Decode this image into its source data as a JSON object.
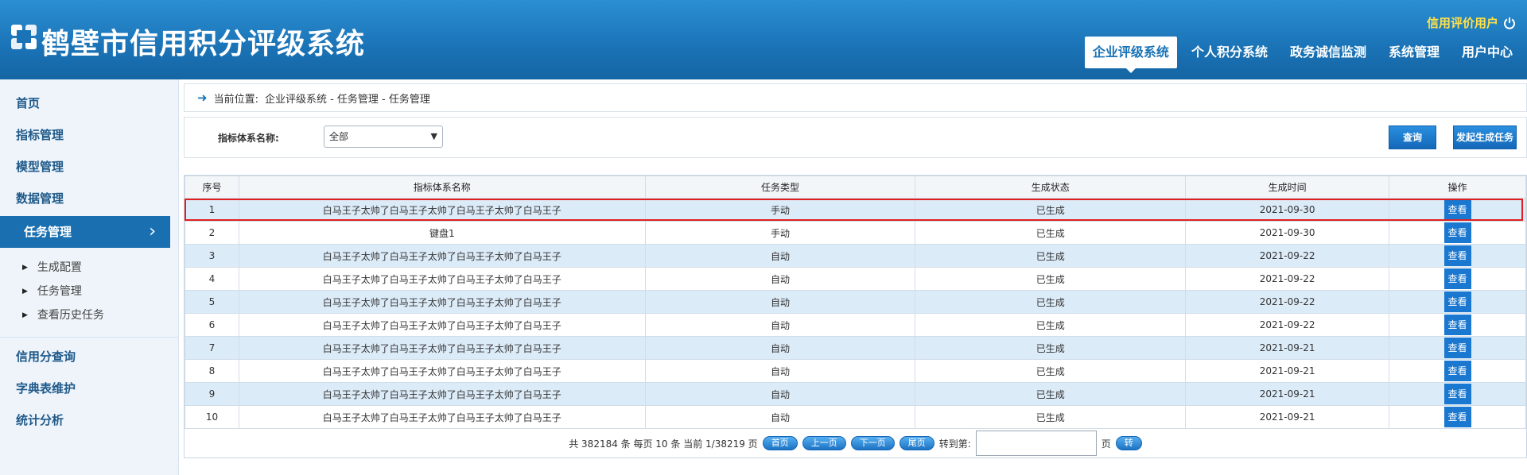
{
  "app": {
    "title": "鹤壁市信用积分评级系统",
    "user": "信用评价用户"
  },
  "top_nav": [
    {
      "label": "企业评级系统",
      "active": true
    },
    {
      "label": "个人积分系统",
      "active": false
    },
    {
      "label": "政务诚信监测",
      "active": false
    },
    {
      "label": "系统管理",
      "active": false
    },
    {
      "label": "用户中心",
      "active": false
    }
  ],
  "sidebar": {
    "items_top": [
      "首页",
      "指标管理",
      "模型管理",
      "数据管理"
    ],
    "active": "任务管理",
    "sub_items": [
      "生成配置",
      "任务管理",
      "查看历史任务"
    ],
    "items_bottom": [
      "信用分查询",
      "字典表维护",
      "统计分析"
    ]
  },
  "breadcrumb": {
    "label": "当前位置:",
    "path": "企业评级系统 - 任务管理 - 任务管理"
  },
  "filter": {
    "label": "指标体系名称:",
    "selected": "全部",
    "query_button": "查询",
    "create_button": "发起生成任务"
  },
  "table": {
    "headers": [
      "序号",
      "指标体系名称",
      "任务类型",
      "生成状态",
      "生成时间",
      "操作"
    ],
    "action_label": "查看",
    "rows": [
      [
        "1",
        "白马王子太帅了白马王子太帅了白马王子太帅了白马王子",
        "手动",
        "已生成",
        "2021-09-30"
      ],
      [
        "2",
        "键盘1",
        "手动",
        "已生成",
        "2021-09-30"
      ],
      [
        "3",
        "白马王子太帅了白马王子太帅了白马王子太帅了白马王子",
        "自动",
        "已生成",
        "2021-09-22"
      ],
      [
        "4",
        "白马王子太帅了白马王子太帅了白马王子太帅了白马王子",
        "自动",
        "已生成",
        "2021-09-22"
      ],
      [
        "5",
        "白马王子太帅了白马王子太帅了白马王子太帅了白马王子",
        "自动",
        "已生成",
        "2021-09-22"
      ],
      [
        "6",
        "白马王子太帅了白马王子太帅了白马王子太帅了白马王子",
        "自动",
        "已生成",
        "2021-09-22"
      ],
      [
        "7",
        "白马王子太帅了白马王子太帅了白马王子太帅了白马王子",
        "自动",
        "已生成",
        "2021-09-21"
      ],
      [
        "8",
        "白马王子太帅了白马王子太帅了白马王子太帅了白马王子",
        "自动",
        "已生成",
        "2021-09-21"
      ],
      [
        "9",
        "白马王子太帅了白马王子太帅了白马王子太帅了白马王子",
        "自动",
        "已生成",
        "2021-09-21"
      ],
      [
        "10",
        "白马王子太帅了白马王子太帅了白马王子太帅了白马王子",
        "自动",
        "已生成",
        "2021-09-21"
      ]
    ]
  },
  "pager": {
    "summary": "共 382184 条 每页 10 条 当前 1/38219 页",
    "first": "首页",
    "prev": "上一页",
    "next": "下一页",
    "last": "尾页",
    "goto_label": "转到第:",
    "page_unit": "页",
    "go": "转"
  },
  "colors": {
    "header": "#1a73b6",
    "accent": "#1a78d0",
    "user_name": "#ffe14a",
    "row_highlight": "#dcebf8",
    "highlight_border": "#e02020"
  },
  "icons": {
    "logo": "logo-icon",
    "power": "power-icon",
    "breadcrumb": "arrow-right-icon",
    "chevron": "chevron-right-icon",
    "bullet": "triangle-right-icon"
  }
}
